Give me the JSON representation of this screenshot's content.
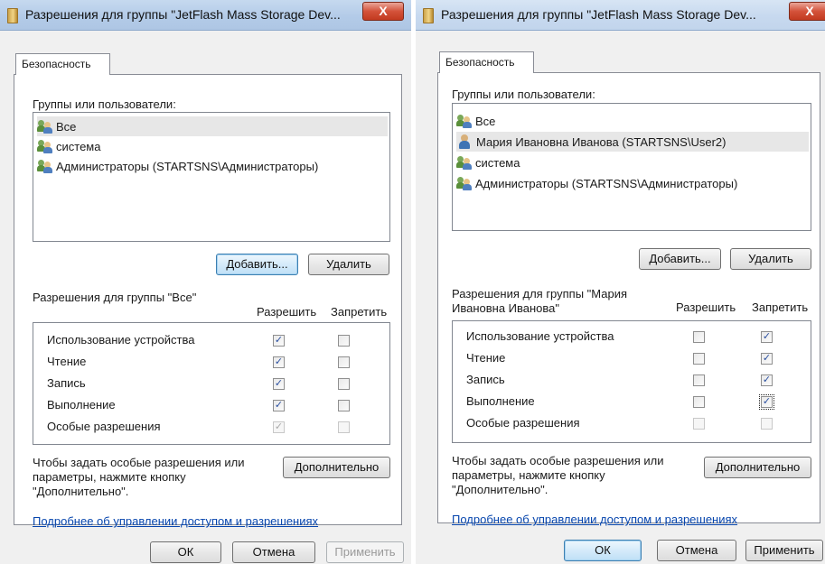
{
  "dialogs": [
    {
      "title": "Разрешения для группы \"JetFlash Mass Storage Dev...",
      "close_label": "X",
      "tab_label": "Безопасность",
      "groups_label": "Группы или пользователи:",
      "principals": [
        {
          "name": "Все",
          "icon": "users-group-icon",
          "selected": true
        },
        {
          "name": "система",
          "icon": "users-group-icon",
          "selected": false
        },
        {
          "name": "Администраторы (STARTSNS\\Администраторы)",
          "icon": "users-group-icon",
          "selected": false
        }
      ],
      "add_button": "Добавить...",
      "remove_button": "Удалить",
      "permissions_for": "Разрешения для группы \"Все\"",
      "col_allow": "Разрешить",
      "col_deny": "Запретить",
      "permissions": [
        {
          "name": "Использование устройства",
          "allow": true,
          "deny": false,
          "allow_disabled": false,
          "deny_disabled": false
        },
        {
          "name": "Чтение",
          "allow": true,
          "deny": false,
          "allow_disabled": false,
          "deny_disabled": false
        },
        {
          "name": "Запись",
          "allow": true,
          "deny": false,
          "allow_disabled": false,
          "deny_disabled": false
        },
        {
          "name": "Выполнение",
          "allow": true,
          "deny": false,
          "allow_disabled": false,
          "deny_disabled": false
        },
        {
          "name": "Особые разрешения",
          "allow": true,
          "deny": false,
          "allow_disabled": true,
          "deny_disabled": true
        }
      ],
      "special_hint_lines": [
        "Чтобы задать особые разрешения или",
        "параметры, нажмите кнопку",
        "\"Дополнительно\"."
      ],
      "advanced_button": "Дополнительно",
      "help_link": "Подробнее об управлении доступом и разрешениях",
      "ok_button": "ОК",
      "cancel_button": "Отмена",
      "apply_button": "Применить"
    },
    {
      "title": "Разрешения для группы \"JetFlash Mass Storage Dev...",
      "close_label": "X",
      "tab_label": "Безопасность",
      "groups_label": "Группы или пользователи:",
      "principals": [
        {
          "name": "Все",
          "icon": "users-group-icon",
          "selected": false
        },
        {
          "name": "Мария Ивановна Иванова (STARTSNS\\User2)",
          "icon": "user-icon",
          "selected": true
        },
        {
          "name": "система",
          "icon": "users-group-icon",
          "selected": false
        },
        {
          "name": "Администраторы (STARTSNS\\Администраторы)",
          "icon": "users-group-icon",
          "selected": false
        }
      ],
      "add_button": "Добавить...",
      "remove_button": "Удалить",
      "permissions_for_lines": [
        "Разрешения для группы \"Мария",
        "Ивановна Иванова\""
      ],
      "col_allow": "Разрешить",
      "col_deny": "Запретить",
      "permissions": [
        {
          "name": "Использование устройства",
          "allow": false,
          "deny": true,
          "allow_disabled": false,
          "deny_disabled": false
        },
        {
          "name": "Чтение",
          "allow": false,
          "deny": true,
          "allow_disabled": false,
          "deny_disabled": false
        },
        {
          "name": "Запись",
          "allow": false,
          "deny": true,
          "allow_disabled": false,
          "deny_disabled": false
        },
        {
          "name": "Выполнение",
          "allow": false,
          "deny": true,
          "allow_disabled": false,
          "deny_disabled": false
        },
        {
          "name": "Особые разрешения",
          "allow": false,
          "deny": false,
          "allow_disabled": true,
          "deny_disabled": true
        }
      ],
      "special_hint_lines": [
        "Чтобы задать особые разрешения или",
        "параметры, нажмите кнопку",
        "\"Дополнительно\"."
      ],
      "advanced_button": "Дополнительно",
      "help_link": "Подробнее об управлении доступом и разрешениях",
      "ok_button": "ОК",
      "cancel_button": "Отмена",
      "apply_button": "Применить"
    }
  ],
  "checkmark": "✓"
}
